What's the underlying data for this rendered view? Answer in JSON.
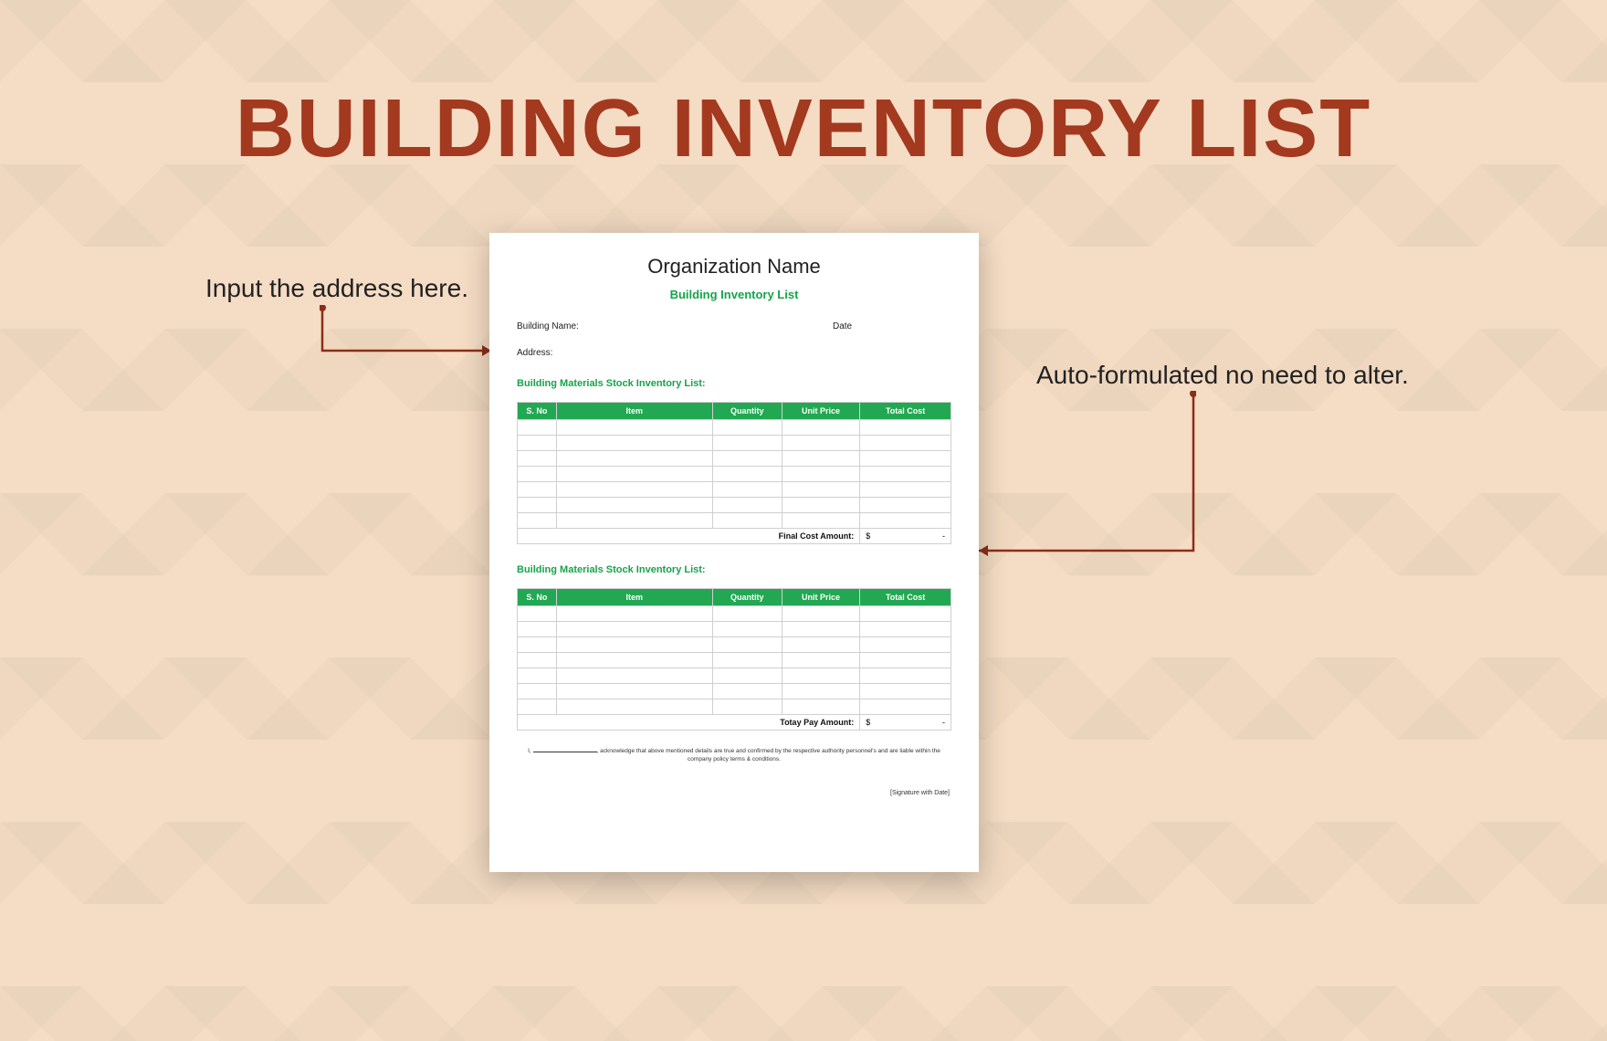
{
  "colors": {
    "accent": "#a3391f",
    "tableHeader": "#22a852",
    "bg": "#f5dcc4"
  },
  "mainTitle": "BUILDING INVENTORY LIST",
  "calloutLeft": "Input the address here.",
  "calloutRight": "Auto-formulated no need to alter.",
  "doc": {
    "orgName": "Organization Name",
    "subtitle": "Building Inventory List",
    "fields": {
      "buildingNameLabel": "Building Name:",
      "dateLabel": "Date",
      "addressLabel": "Address:"
    },
    "section1": {
      "title": "Building Materials Stock Inventory List:",
      "columns": {
        "sno": "S. No",
        "item": "Item",
        "qty": "Quantity",
        "price": "Unit Price",
        "total": "Total Cost"
      },
      "footerLabel": "Final Cost Amount:",
      "footerCurrency": "$",
      "footerDash": "-",
      "rowCount": 7
    },
    "section2": {
      "title": "Building Materials Stock Inventory List:",
      "columns": {
        "sno": "S. No",
        "item": "Item",
        "qty": "Quantity",
        "price": "Unit Price",
        "total": "Total Cost"
      },
      "footerLabel": "Totay Pay Amount:",
      "footerCurrency": "$",
      "footerDash": "-",
      "rowCount": 7
    },
    "declarationPrefix": "I, ",
    "declarationLine1": ", acknowledge that above mentioned details are true and confirmed by the respective authority personnel's and are liable within the",
    "declarationLine2": "company policy terms & conditions.",
    "signature": "[Signature with Date]"
  }
}
